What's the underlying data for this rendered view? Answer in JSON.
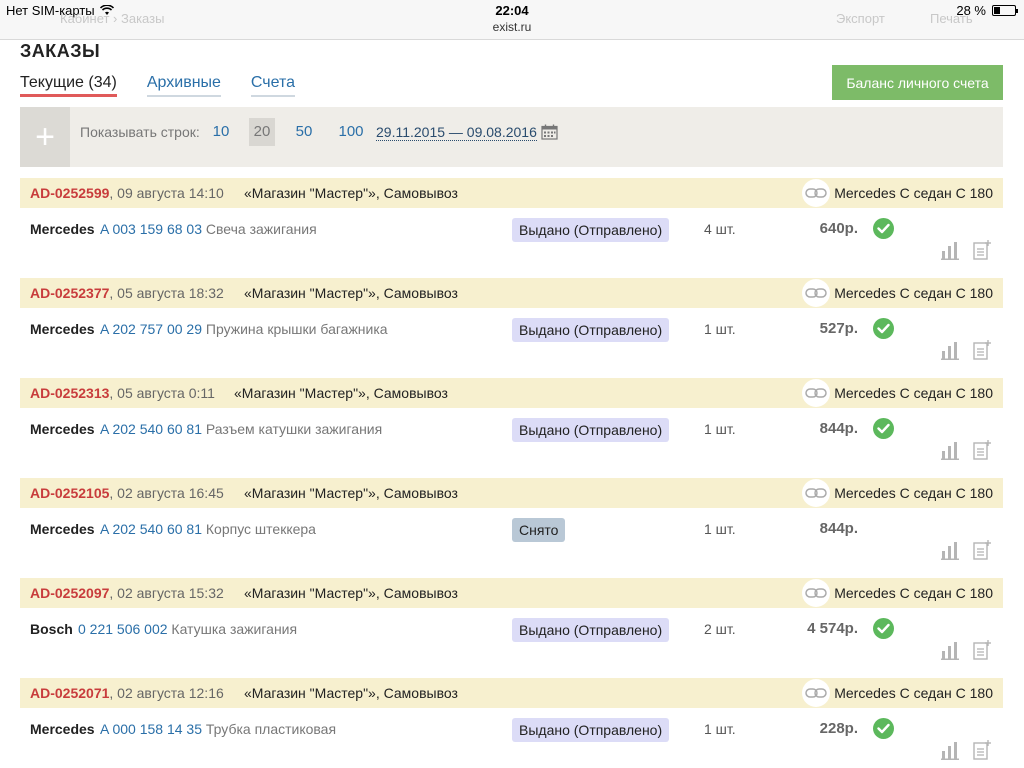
{
  "statusbar": {
    "carrier": "Нет SIM-карты",
    "time": "22:04",
    "url": "exist.ru",
    "battery": "28 %",
    "battery_level": 0.28,
    "ghost_left": "Кабинет › Заказы",
    "ghost_export": "Экспорт",
    "ghost_print": "Печать"
  },
  "page": {
    "title": "ЗАКАЗЫ",
    "tabs": [
      {
        "label": "Текущие (34)",
        "active": true
      },
      {
        "label": "Архивные",
        "active": false
      },
      {
        "label": "Счета",
        "active": false
      }
    ],
    "balance_button": "Баланс личного счета"
  },
  "filter": {
    "add_label": "+",
    "show_rows_label": "Показывать строк:",
    "rows_options": [
      "10",
      "20",
      "50",
      "100"
    ],
    "rows_selected": "20",
    "date_range": "29.11.2015 — 09.08.2016"
  },
  "orders": [
    {
      "id": "AD-0252599",
      "date": ", 09 августа 14:10",
      "store": "«Магазин \"Мастер\"», Самовывоз",
      "car": "Mercedes С седан С 180",
      "brand": "Mercedes",
      "article": "A 003 159 68 03",
      "name": "Свеча зажигания",
      "status": "Выдано (Отправлено)",
      "status_type": "ok",
      "qty": "4 шт.",
      "price": "640р.",
      "done": true
    },
    {
      "id": "AD-0252377",
      "date": ", 05 августа 18:32",
      "store": "«Магазин \"Мастер\"», Самовывоз",
      "car": "Mercedes С седан С 180",
      "brand": "Mercedes",
      "article": "A 202 757 00 29",
      "name": "Пружина крышки багажника",
      "status": "Выдано (Отправлено)",
      "status_type": "ok",
      "qty": "1 шт.",
      "price": "527р.",
      "done": true
    },
    {
      "id": "AD-0252313",
      "date": ", 05 августа 0:11",
      "store": "«Магазин \"Мастер\"», Самовывоз",
      "car": "Mercedes С седан С 180",
      "brand": "Mercedes",
      "article": "A 202 540 60 81",
      "name": "Разъем катушки зажигания",
      "status": "Выдано (Отправлено)",
      "status_type": "ok",
      "qty": "1 шт.",
      "price": "844р.",
      "done": true
    },
    {
      "id": "AD-0252105",
      "date": ", 02 августа 16:45",
      "store": "«Магазин \"Мастер\"», Самовывоз",
      "car": "Mercedes С седан С 180",
      "brand": "Mercedes",
      "article": "A 202 540 60 81",
      "name": "Корпус штеккера",
      "status": "Снято",
      "status_type": "removed",
      "qty": "1 шт.",
      "price": "844р.",
      "done": false
    },
    {
      "id": "AD-0252097",
      "date": ", 02 августа 15:32",
      "store": "«Магазин \"Мастер\"», Самовывоз",
      "car": "Mercedes С седан С 180",
      "brand": "Bosch",
      "article": "0 221 506 002",
      "name": "Катушка зажигания",
      "status": "Выдано (Отправлено)",
      "status_type": "ok",
      "qty": "2 шт.",
      "price": "4 574р.",
      "done": true
    },
    {
      "id": "AD-0252071",
      "date": ", 02 августа 12:16",
      "store": "«Магазин \"Мастер\"», Самовывоз",
      "car": "Mercedes С седан С 180",
      "brand": "Mercedes",
      "article": "A 000 158 14 35",
      "name": "Трубка пластиковая",
      "status": "Выдано (Отправлено)",
      "status_type": "ok",
      "qty": "1 шт.",
      "price": "228р.",
      "done": true
    }
  ],
  "colors": {
    "accent_red": "#c83c3c",
    "link_blue": "#2a6fa8",
    "balance_green": "#7dbb68",
    "order_header_bg": "#f7f0cf",
    "status_ok_bg": "#dcdcf7",
    "status_removed_bg": "#b9c8d6",
    "check_green": "#5cb85c"
  },
  "icons": [
    "wifi-icon",
    "plus-icon",
    "calendar-icon",
    "link-icon",
    "check-icon",
    "chart-icon",
    "notes-add-icon"
  ]
}
